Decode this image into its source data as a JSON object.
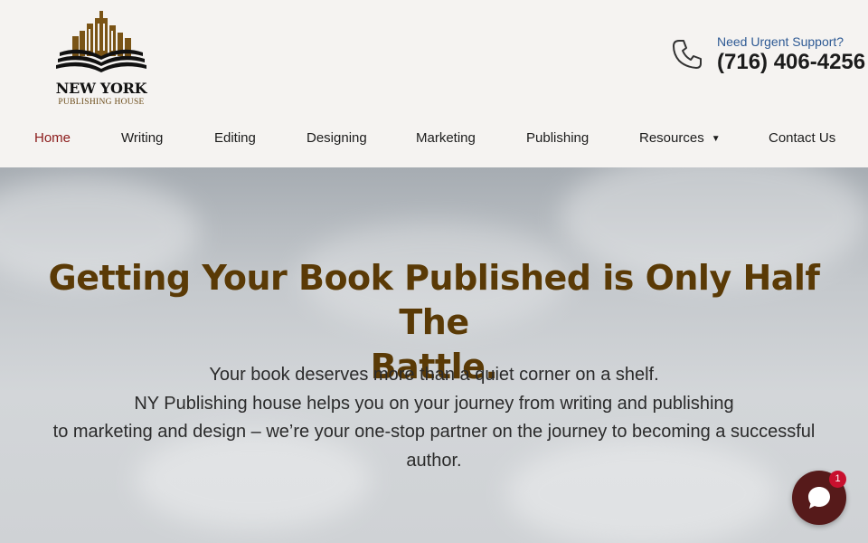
{
  "logo": {
    "title": "NEW YORK",
    "subtitle": "PUBLISHING HOUSE",
    "icon": "book-skyline-logo"
  },
  "support": {
    "label": "Need Urgent Support?",
    "phone": "(716) 406-4256",
    "icon": "phone-icon"
  },
  "nav": {
    "items": [
      {
        "label": "Home",
        "active": true
      },
      {
        "label": "Writing"
      },
      {
        "label": "Editing"
      },
      {
        "label": "Designing"
      },
      {
        "label": "Marketing"
      },
      {
        "label": "Publishing"
      },
      {
        "label": "Resources",
        "has_dropdown": true
      },
      {
        "label": "Contact Us"
      }
    ]
  },
  "hero": {
    "title_line1": "Getting Your Book Published is Only Half The",
    "title_line2": "Battle.",
    "lines": [
      "Your book deserves more than a quiet corner on a shelf.",
      "NY Publishing house helps you on your journey from writing and publishing",
      "to marketing and design – we’re your one-stop partner on the journey to becoming a successful",
      "author."
    ]
  },
  "chat": {
    "badge": "1",
    "icon": "chat-bubble-icon"
  },
  "colors": {
    "accent_active": "#8b1a1a",
    "title_brown": "#5a3a06",
    "support_blue": "#2e5a94",
    "chat_bg": "#561a1a",
    "badge_red": "#c8102e"
  }
}
